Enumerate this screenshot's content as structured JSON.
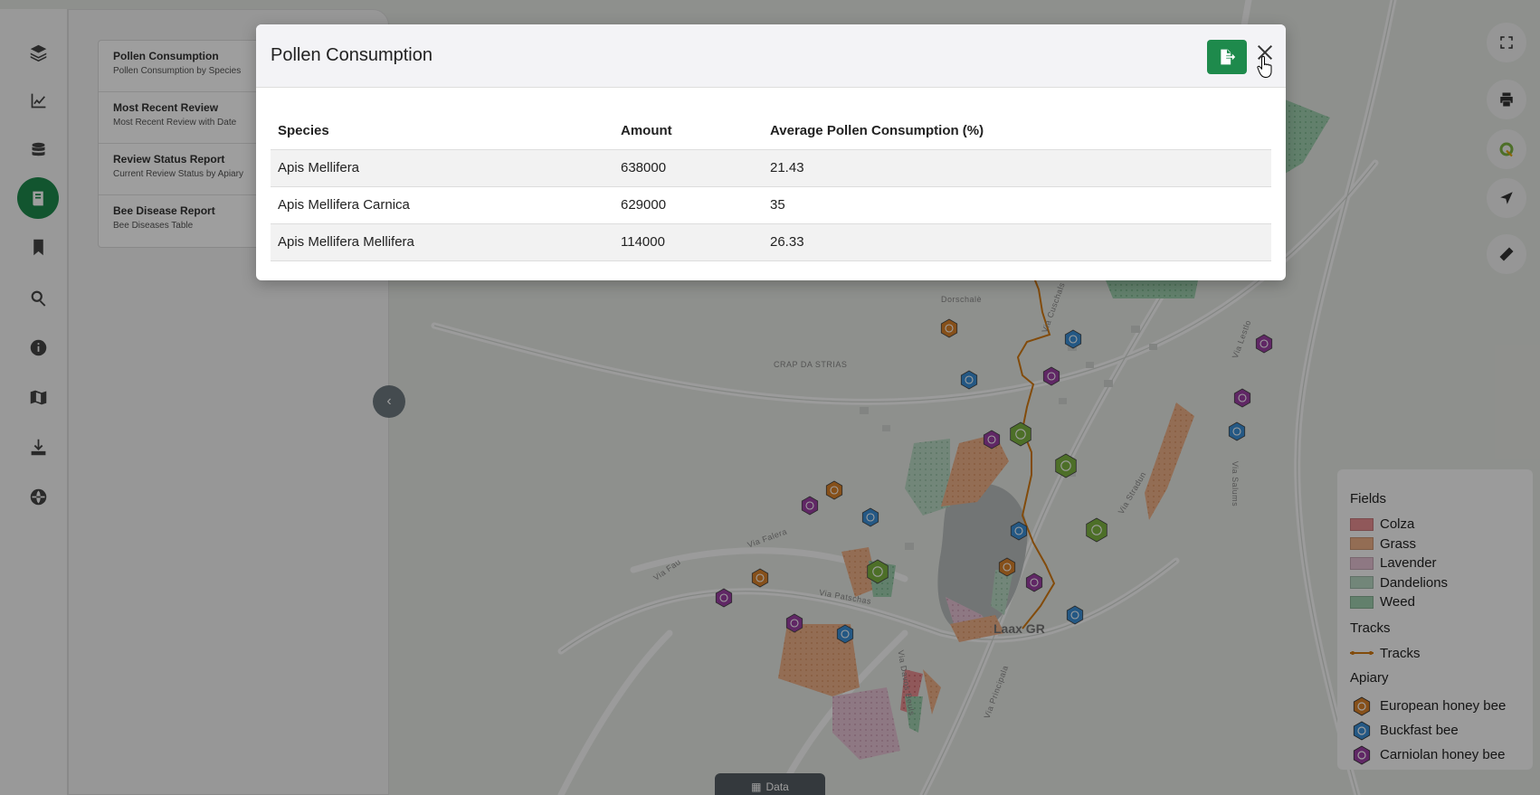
{
  "sidebar_icons": [
    {
      "name": "layers-icon"
    },
    {
      "name": "chart-line-icon"
    },
    {
      "name": "database-icon"
    },
    {
      "name": "book-icon",
      "active": true
    },
    {
      "name": "bookmark-icon"
    },
    {
      "name": "search-icon"
    },
    {
      "name": "info-icon"
    },
    {
      "name": "map-icon"
    },
    {
      "name": "download-icon"
    },
    {
      "name": "globe-icon"
    }
  ],
  "reports": [
    {
      "title": "Pollen Consumption",
      "subtitle": "Pollen Consumption by Species"
    },
    {
      "title": "Most Recent Review",
      "subtitle": "Most Recent Review with Date"
    },
    {
      "title": "Review Status Report",
      "subtitle": "Current Review Status by Apiary"
    },
    {
      "title": "Bee Disease Report",
      "subtitle": "Bee Diseases Table"
    }
  ],
  "map": {
    "labels": [
      "CRAP DA STRIAS",
      "Via Falera",
      "Via Stradun",
      "Via Principala",
      "Via Salums",
      "Via Fau",
      "Via Patschas",
      "Via Cuschals",
      "Via Davos Beuls",
      "Via Lestlo",
      "Dorschalè"
    ],
    "town": "Laax GR"
  },
  "controls": [
    "fullscreen-icon",
    "print-icon",
    "qgis-icon",
    "locate-icon",
    "measure-icon"
  ],
  "legend": {
    "fields_heading": "Fields",
    "fields": [
      {
        "label": "Colza",
        "color": "#e88f92"
      },
      {
        "label": "Grass",
        "color": "#eeb088"
      },
      {
        "label": "Lavender",
        "color": "#e5c2d3"
      },
      {
        "label": "Dandelions",
        "color": "#b9d8c3"
      },
      {
        "label": "Weed",
        "color": "#9fcfae"
      }
    ],
    "tracks_heading": "Tracks",
    "tracks_label": "Tracks",
    "track_color": "#d27a12",
    "apiary_heading": "Apiary",
    "apiary": [
      {
        "label": "European honey bee",
        "color": "#d9822b"
      },
      {
        "label": "Buckfast bee",
        "color": "#3a8fd6"
      },
      {
        "label": "Carniolan honey bee",
        "color": "#9b3fa4"
      }
    ]
  },
  "data_tab": {
    "label": "Data"
  },
  "modal": {
    "title": "Pollen Consumption",
    "export_icon": "file-export-icon",
    "close_icon": "close-icon",
    "columns": [
      "Species",
      "Amount",
      "Average Pollen Consumption (%)"
    ],
    "rows": [
      [
        "Apis Mellifera",
        "638000",
        "21.43"
      ],
      [
        "Apis Mellifera Carnica",
        "629000",
        "35"
      ],
      [
        "Apis Mellifera Mellifera",
        "114000",
        "26.33"
      ]
    ]
  }
}
